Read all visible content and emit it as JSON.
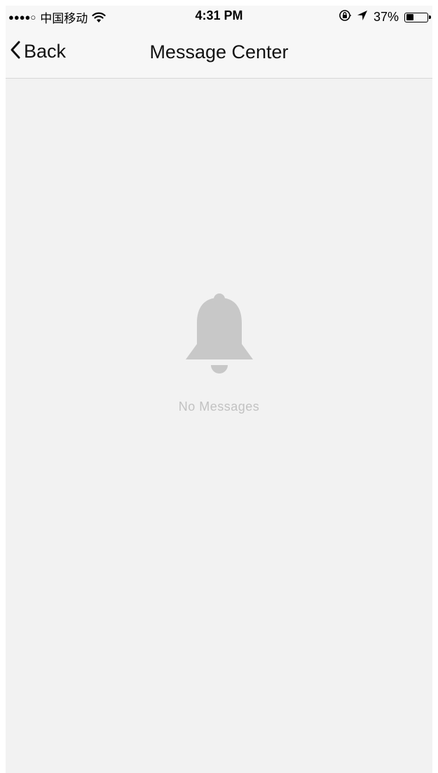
{
  "status_bar": {
    "signal": "●●●●○",
    "carrier": "中国移动",
    "wifi_icon": "wifi-icon",
    "time": "4:31 PM",
    "lock_icon": "orientation-lock-icon",
    "location_icon": "location-arrow-icon",
    "battery_percent": "37%",
    "battery_level": 0.37
  },
  "nav": {
    "back_label": "Back",
    "title": "Message Center"
  },
  "empty_state": {
    "icon": "bell-icon",
    "message": "No Messages"
  },
  "colors": {
    "background": "#f2f2f2",
    "bar_background": "#f7f7f7",
    "icon_gray": "#c8c8c8",
    "empty_text": "#c2c2c2"
  }
}
